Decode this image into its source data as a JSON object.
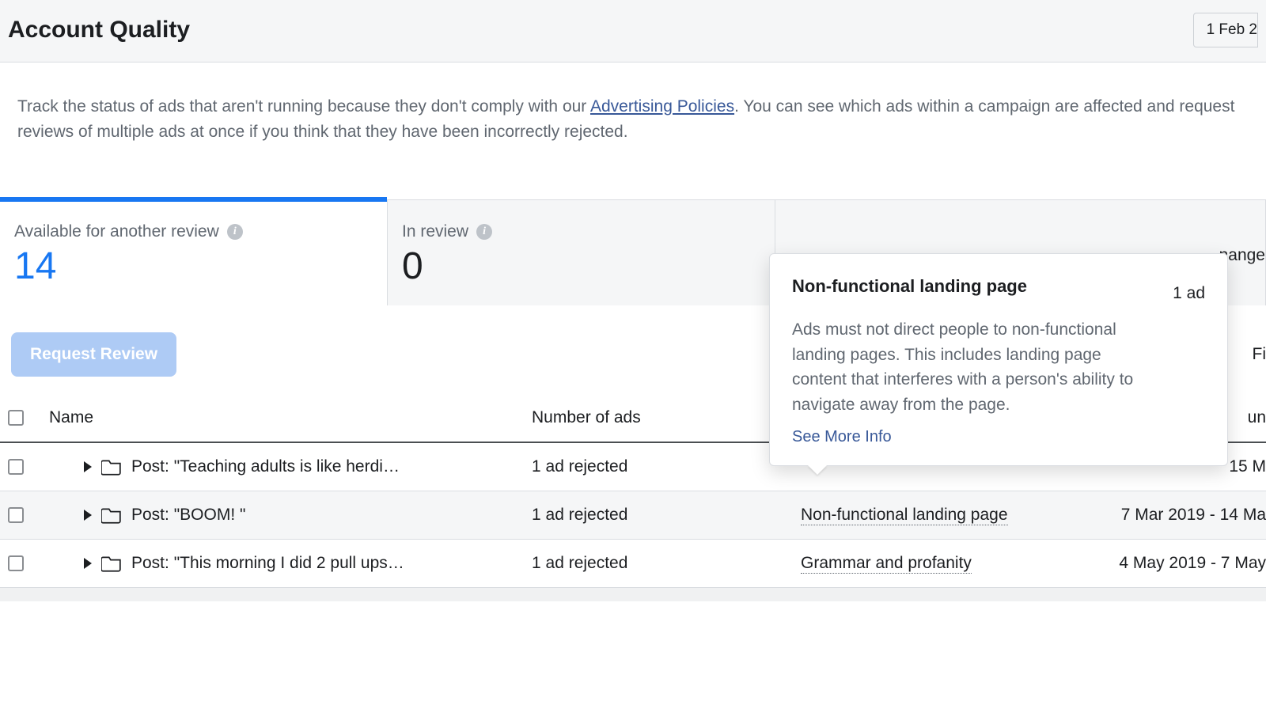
{
  "header": {
    "title": "Account Quality",
    "date_range_label": "1 Feb 2"
  },
  "intro": {
    "text_before": "Track the status of ads that aren't running because they don't comply with our ",
    "link_label": "Advertising Policies",
    "text_after": ". You can see which ads within a campaign are affected and request reviews of multiple ads at once if you think that they have been incorrectly rejected."
  },
  "tabs": {
    "available": {
      "label": "Available for another review",
      "count": "14"
    },
    "in_review": {
      "label": "In review",
      "count": "0"
    },
    "trailing_label": "nange"
  },
  "actions": {
    "request_review": "Request Review",
    "filter_label": "Fi"
  },
  "table": {
    "headers": {
      "name": "Name",
      "number": "Number of ads",
      "date_trailing": "un"
    },
    "rows": [
      {
        "name": "Post: \"Teaching adults is like herdi…",
        "number": "1 ad rejected",
        "reason": "",
        "date": "15 M"
      },
      {
        "name": "Post: \"BOOM! \"",
        "number": "1 ad rejected",
        "reason": "Non-functional landing page",
        "date": "7 Mar 2019 - 14 Ma"
      },
      {
        "name": "Post: \"This morning I did 2 pull ups…",
        "number": "1 ad rejected",
        "reason": "Grammar and profanity",
        "date": "4 May 2019 - 7 May"
      }
    ]
  },
  "tooltip": {
    "title": "Non-functional landing page",
    "count_label": "1 ad",
    "body": "Ads must not direct people to non-functional landing pages. This includes landing page content that interferes with a person's ability to navigate away from the page.",
    "link_label": "See More Info"
  }
}
